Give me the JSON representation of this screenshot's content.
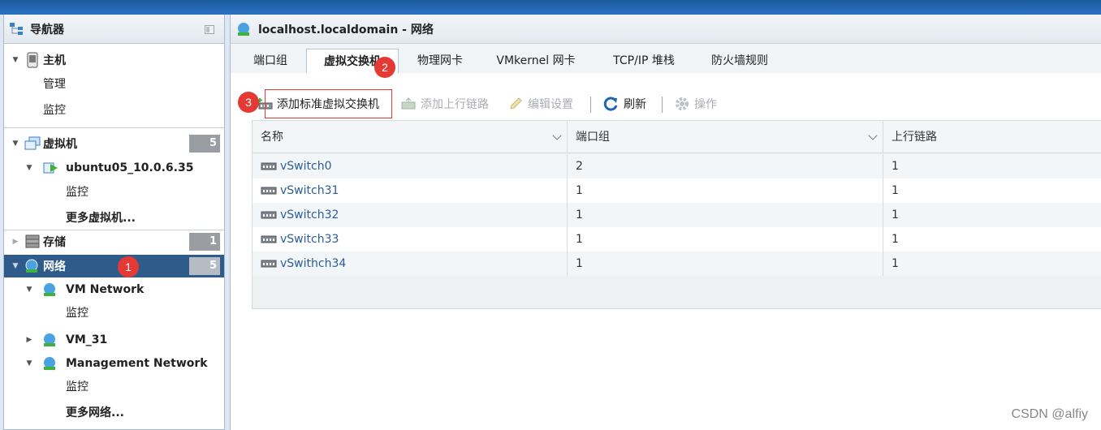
{
  "navigator": {
    "title": "导航器",
    "host": {
      "label": "主机",
      "children": [
        "管理",
        "监控"
      ]
    },
    "vms": {
      "label": "虚拟机",
      "count": "5",
      "vm": {
        "label": "ubuntu05_10.0.6.35",
        "children": [
          "监控"
        ]
      },
      "more": "更多虚拟机..."
    },
    "storage": {
      "label": "存储",
      "count": "1"
    },
    "network": {
      "label": "网络",
      "count": "5",
      "items": [
        {
          "label": "VM Network",
          "child": "监控"
        },
        {
          "label": "VM_31"
        },
        {
          "label": "Management Network",
          "child": "监控"
        }
      ],
      "more": "更多网络..."
    }
  },
  "markers": [
    "1",
    "2",
    "3"
  ],
  "main": {
    "title": "localhost.localdomain - 网络",
    "tabs": [
      "端口组",
      "虚拟交换机",
      "物理网卡",
      "VMkernel 网卡",
      "TCP/IP 堆栈",
      "防火墙规则"
    ],
    "active_tab": "虚拟交换机",
    "toolbar": {
      "add_switch": "添加标准虚拟交换机",
      "add_uplink": "添加上行链路",
      "edit": "编辑设置",
      "refresh": "刷新",
      "actions": "操作"
    },
    "table": {
      "columns": [
        "名称",
        "端口组",
        "上行链路"
      ],
      "rows": [
        [
          "vSwitch0",
          "2",
          "1"
        ],
        [
          "vSwitch31",
          "1",
          "1"
        ],
        [
          "vSwitch32",
          "1",
          "1"
        ],
        [
          "vSwitch33",
          "1",
          "1"
        ],
        [
          "vSwithch34",
          "1",
          "1"
        ]
      ]
    }
  },
  "watermark": "CSDN @alfiy",
  "colors": {
    "selected": "#2f5b8a",
    "link": "#2a5d94",
    "marker": "#e53935"
  }
}
